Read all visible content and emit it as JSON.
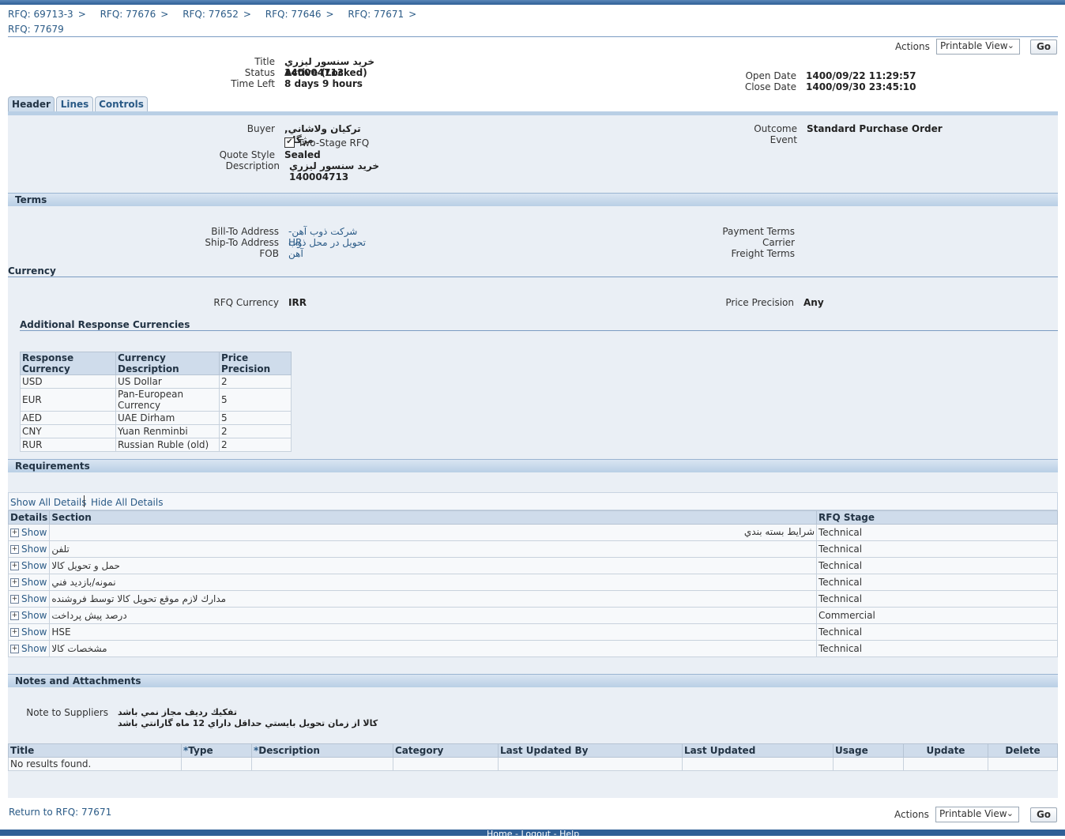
{
  "breadcrumbs": [
    "RFQ: 69713-3",
    "RFQ: 77676",
    "RFQ: 77652",
    "RFQ: 77646",
    "RFQ: 77671"
  ],
  "breadcrumb_separator": ">",
  "page_title": "RFQ: 77679",
  "actions": {
    "label": "Actions",
    "selected": "Printable View",
    "go": "Go"
  },
  "summary": {
    "title_label": "Title",
    "title": "خريد سنسور ليزري 140004713",
    "status_label": "Status",
    "status": "Active (Locked)",
    "timeleft_label": "Time Left",
    "timeleft": "8 days 9 hours",
    "open_label": "Open Date",
    "open_date": "1400/09/22 11:29:57",
    "close_label": "Close Date",
    "close_date": "1400/09/30 23:45:10"
  },
  "tabs": [
    "Header",
    "Lines",
    "Controls"
  ],
  "header": {
    "buyer_label": "Buyer",
    "buyer": "تركيان ولاشاني, مژگان",
    "two_stage": "Two-Stage RFQ",
    "quote_style_label": "Quote Style",
    "quote_style": "Sealed",
    "description_label": "Description",
    "description": "خريد سنسور ليزري 140004713",
    "outcome_label": "Outcome",
    "outcome": "Standard Purchase Order",
    "event_label": "Event"
  },
  "terms": {
    "heading": "Terms",
    "bill_to_label": "Bill-To Address",
    "bill_to": "شركت ذوب آهن-HR",
    "ship_to_label": "Ship-To Address",
    "ship_to": "تحويل در محل ذوب آهن",
    "fob_label": "FOB",
    "payment_label": "Payment Terms",
    "carrier_label": "Carrier",
    "freight_label": "Freight Terms"
  },
  "currency": {
    "heading": "Currency",
    "rfq_currency_label": "RFQ Currency",
    "rfq_currency": "IRR",
    "price_precision_label": "Price Precision",
    "price_precision": "Any",
    "additional_heading": "Additional Response Currencies",
    "columns": [
      "Response Currency",
      "Currency Description",
      "Price Precision"
    ],
    "rows": [
      [
        "USD",
        "US Dollar",
        "2"
      ],
      [
        "EUR",
        "Pan-European Currency",
        "5"
      ],
      [
        "AED",
        "UAE Dirham",
        "5"
      ],
      [
        "CNY",
        "Yuan Renminbi",
        "2"
      ],
      [
        "RUR",
        "Russian Ruble (old)",
        "2"
      ]
    ]
  },
  "requirements": {
    "heading": "Requirements",
    "show_all": "Show All Details",
    "hide_all": "Hide All Details",
    "columns": [
      "Details",
      "Section",
      "RFQ Stage"
    ],
    "show_label": "Show",
    "rows": [
      {
        "section": "شرايط بسته بندي",
        "stage": "Technical"
      },
      {
        "section": "تلفن",
        "stage": "Technical"
      },
      {
        "section": "حمل و تحويل كالا",
        "stage": "Technical"
      },
      {
        "section": "نمونه/بازديد فني",
        "stage": "Technical"
      },
      {
        "section": "مدارك لازم موقع تحويل كالا توسط فروشنده",
        "stage": "Technical"
      },
      {
        "section": "درصد پيش پرداخت",
        "stage": "Commercial"
      },
      {
        "section": "HSE",
        "stage": "Technical"
      },
      {
        "section": "مشخصات كالا",
        "stage": "Technical"
      }
    ]
  },
  "notes": {
    "heading": "Notes and Attachments",
    "note_label": "Note to Suppliers",
    "note_line1": "تفكيك رديف مجاز نمي باشد",
    "note_line2": "كالا از زمان تحويل بايستي حداقل داراي 12 ماه گارانتي باشد",
    "columns": [
      "Title",
      "Type",
      "Description",
      "Category",
      "Last Updated By",
      "Last Updated",
      "Usage",
      "Update",
      "Delete"
    ],
    "required_mark": "*",
    "empty": "No results found."
  },
  "footer": {
    "return_link": "Return to RFQ: 77671",
    "links": [
      "Home",
      "Logout",
      "Help"
    ]
  },
  "colors": {
    "accent": "#2a5a86",
    "section_header": "#c5d8eb",
    "panel": "#eaeff5"
  }
}
